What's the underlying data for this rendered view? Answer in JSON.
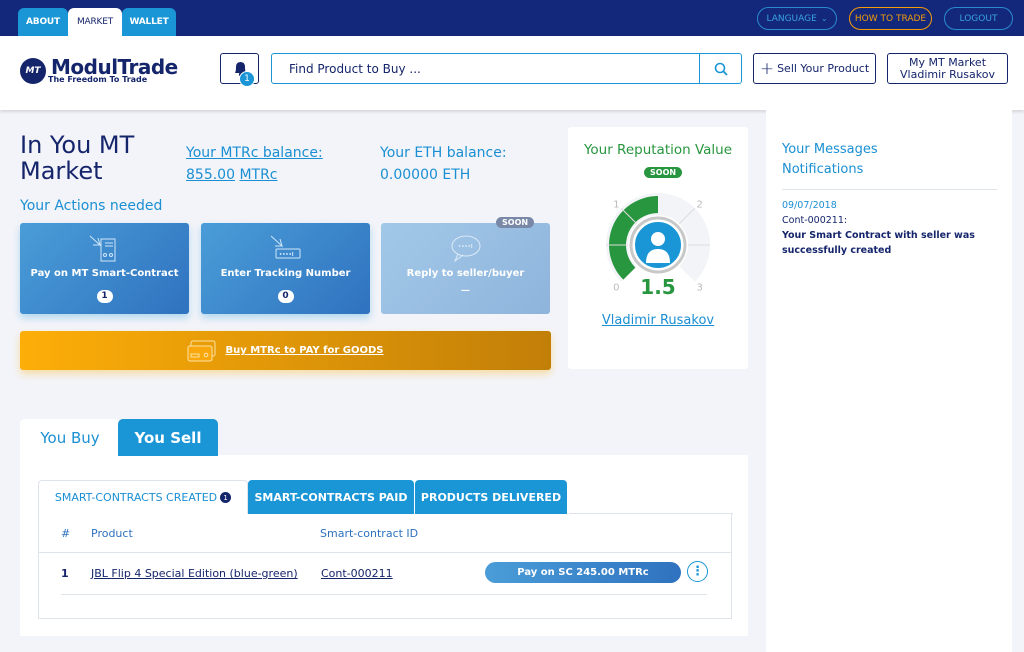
{
  "topnav": {
    "tabs": [
      {
        "label": "ABOUT"
      },
      {
        "label": "MARKET"
      },
      {
        "label": "WALLET"
      }
    ],
    "language": "LANGUAGE",
    "how_to_trade": "HOW TO TRADE",
    "logout": "LOGOUT"
  },
  "header": {
    "logo_mark": "MT",
    "logo_name": "ModulTrade",
    "logo_tagline": "The Freedom To Trade",
    "notification_count": "1",
    "search_placeholder": "Find Product to Buy ...",
    "sell_label": "Sell Your Product",
    "my_market_line1": "My MT Market",
    "my_market_line2": "Vladimir Rusakov"
  },
  "main": {
    "title_line1": "In You MT",
    "title_line2": "Market",
    "mtrc_label": "Your MTRc balance:",
    "mtrc_value": "855.00",
    "mtrc_unit": "MTRc",
    "eth_label": "Your ETH balance:",
    "eth_value": "0.00000 ETH",
    "actions_title": "Your Actions needed",
    "actions": [
      {
        "label": "Pay on MT Smart-Contract",
        "count": "1"
      },
      {
        "label": "Enter Tracking Number",
        "count": "0"
      },
      {
        "label": "Reply to seller/buyer",
        "count": "—",
        "badge": "SOON"
      }
    ],
    "buy_mtrc": "Buy MTRc to PAY for GOODS"
  },
  "reputation": {
    "title": "Your Reputation Value",
    "badge": "SOON",
    "value": 1.5,
    "value_label": "1.5",
    "scale": [
      "0",
      "1",
      "2",
      "3"
    ],
    "user": "Vladimir Rusakov",
    "color": "#27963f"
  },
  "messages": {
    "title_line1": "Your Messages",
    "title_line2": "Notifications",
    "items": [
      {
        "date": "09/07/2018",
        "ref": "Cont-000211:",
        "text": "Your Smart Contract with seller was successfully created"
      }
    ]
  },
  "trade": {
    "tabs": [
      {
        "label": "You Buy"
      },
      {
        "label": "You Sell"
      }
    ],
    "subtabs": [
      {
        "label": "SMART-CONTRACTS CREATED",
        "count": "1"
      },
      {
        "label": "SMART-CONTRACTS PAID"
      },
      {
        "label": "PRODUCTS DELIVERED"
      }
    ],
    "columns": [
      "#",
      "Product",
      "Smart-contract ID"
    ],
    "rows": [
      {
        "num": "1",
        "product": "JBL Flip 4 Special Edition (blue-green)",
        "contract": "Cont-000211",
        "action": "Pay on SC 245.00 MTRc"
      }
    ]
  }
}
